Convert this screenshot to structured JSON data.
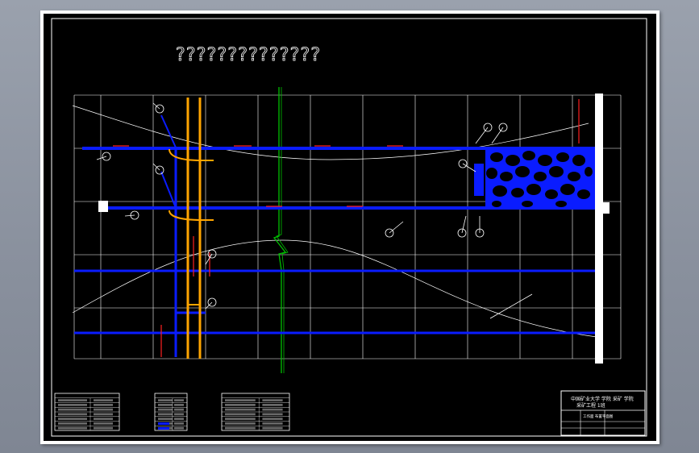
{
  "drawing": {
    "title": "??????????????"
  },
  "title_block": {
    "line1": "中国矿业大学 学院 采矿 学院",
    "line2": "采矿工程 1班",
    "line3": "工作面 布置平面图"
  },
  "colors": {
    "background": "#000000",
    "sheet": "#ffffff",
    "roadway": "#0a1cff",
    "belt": "#ffa500",
    "grid": "#ffffff",
    "fault": "#00c000",
    "marker": "#ff2020"
  }
}
